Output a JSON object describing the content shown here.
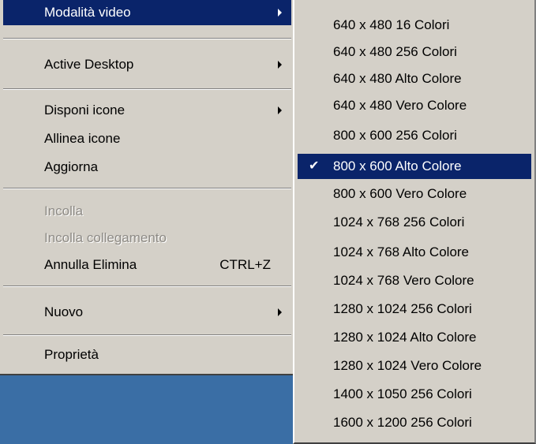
{
  "main_menu": {
    "video_mode_label": "Modalità video",
    "active_desktop_label": "Active Desktop",
    "arrange_icons_label": "Disponi icone",
    "line_up_icons_label": "Allinea icone",
    "refresh_label": "Aggiorna",
    "paste_label": "Incolla",
    "paste_shortcut_label": "Incolla collegamento",
    "undo_delete_label": "Annulla Elimina",
    "undo_delete_shortcut": "CTRL+Z",
    "new_label": "Nuovo",
    "properties_label": "Proprietà"
  },
  "video_modes": {
    "selected": "800 x 600 Alto Colore",
    "items": [
      "640 x 480 16 Colori",
      "640 x 480 256 Colori",
      "640 x 480 Alto Colore",
      "640 x 480 Vero Colore",
      "800 x 600 256 Colori",
      "800 x 600 Alto Colore",
      "800 x 600 Vero Colore",
      "1024 x 768 256 Colori",
      "1024 x 768 Alto Colore",
      "1024 x 768 Vero Colore",
      "1280 x 1024 256 Colori",
      "1280 x 1024 Alto Colore",
      "1280 x 1024 Vero Colore",
      "1400 x 1050 256 Colori",
      "1600 x 1200 256 Colori"
    ]
  },
  "colors": {
    "highlight": "#0a246a",
    "menu_bg": "#d4d0c8",
    "desktop": "#3a6ea5"
  }
}
